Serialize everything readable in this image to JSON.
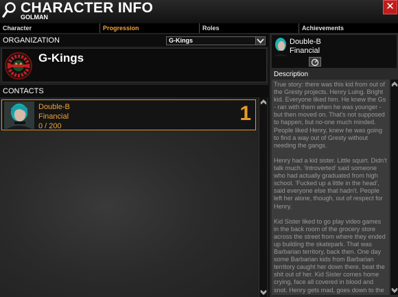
{
  "header": {
    "title": "CHARACTER INFO",
    "subtitle": "GOLMAN",
    "close_label": "✕"
  },
  "tabs": [
    {
      "label": "Character",
      "active": false
    },
    {
      "label": "Progression",
      "active": true
    },
    {
      "label": "Roles",
      "active": false
    },
    {
      "label": "Achievements",
      "active": false
    }
  ],
  "organization": {
    "section_label": "ORGANIZATION",
    "selected_value": "G-Kings",
    "name": "G-Kings"
  },
  "contacts": {
    "section_label": "CONTACTS",
    "items": [
      {
        "name": "Double-B",
        "role": "Financial",
        "progress": "0 / 200",
        "level": "1"
      }
    ]
  },
  "profile": {
    "name": "Double-B",
    "role": "Financial",
    "description_label": "Description",
    "description": "True story:  there was this kid from out of the Gresty projects.  Henry Luing.  Bright kid.  Everyone liked him.  He knew the Gs - ran with them when he was younger - but then moved on.  That's not supposed to happen, but no-one much minded. People liked Henry, knew he was going to find a way out of Gresty without needing the gangs.\n\nHenry had a kid sister.  Little squirt. Didn't talk much.  'Introverted' said someone who had actually graduated from high school.  'Fucked up a little in the head', said everyone else that hadn't.  People left her alone, though, out of respect for Henry.\n\nKid Sister liked to go play video games in the back room of the grocery store across the street from where they ended up building the skatepark.  That was Barbarian territory, back then.  One day some Barbarian kids from Barbarian territory caught her down there, beat the shit out of her.  Kid Sister comes home crying, face all covered in blood and snot.  Henry gets mad, goes down to the store to get some reconstitution."
  },
  "colors": {
    "accent": "#f0a43a",
    "close_red": "#c01d1d",
    "panel_dark": "#0c0c0c"
  },
  "icons": [
    "search-icon",
    "close-icon",
    "chevron-down-icon",
    "gang-emblem",
    "portrait",
    "info-icon"
  ]
}
